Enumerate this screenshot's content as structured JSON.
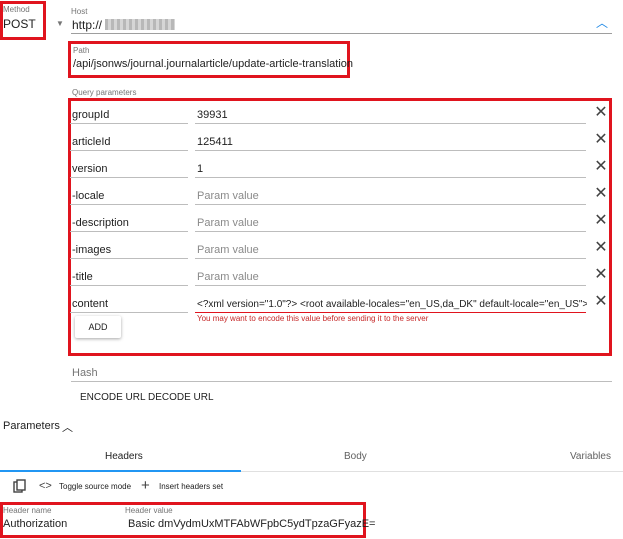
{
  "request": {
    "method_label": "Method",
    "method_value": "POST",
    "host_label": "Host",
    "host_value": "http://",
    "path_label": "Path",
    "path_value": "/api/jsonws/journal.journalarticle/update-article-translation"
  },
  "query": {
    "section_label": "Query parameters",
    "params": [
      {
        "name": "groupId",
        "value": "39931"
      },
      {
        "name": "articleId",
        "value": "125411"
      },
      {
        "name": "version",
        "value": "1"
      },
      {
        "name": "-locale",
        "placeholder": "Param value"
      },
      {
        "name": "-description",
        "placeholder": "Param value"
      },
      {
        "name": "-images",
        "placeholder": "Param value"
      },
      {
        "name": "-title",
        "placeholder": "Param value"
      },
      {
        "name": "content",
        "value": "<?xml version=\"1.0\"?> <root available-locales=\"en_US,da_DK\" default-locale=\"en_US\">"
      }
    ],
    "warning": "You may want to encode this value before sending it to the server",
    "add_label": "ADD"
  },
  "hash": {
    "label": "Hash"
  },
  "url_actions": {
    "encode": "ENCODE URL",
    "decode": "DECODE URL"
  },
  "parameters": {
    "title": "Parameters",
    "tabs": [
      "Headers",
      "Body",
      "Variables"
    ],
    "toolbar": {
      "toggle": "Toggle source mode",
      "insert": "Insert headers set"
    },
    "header": {
      "name_label": "Header name",
      "value_label": "Header value",
      "name": "Authorization",
      "value": "Basic dmVydmUxMTFAbWFpbC5ydTpzaGFyazE="
    }
  },
  "colors": {
    "highlight": "#e0141e",
    "accent": "#2196f3",
    "warning": "#c62828"
  }
}
